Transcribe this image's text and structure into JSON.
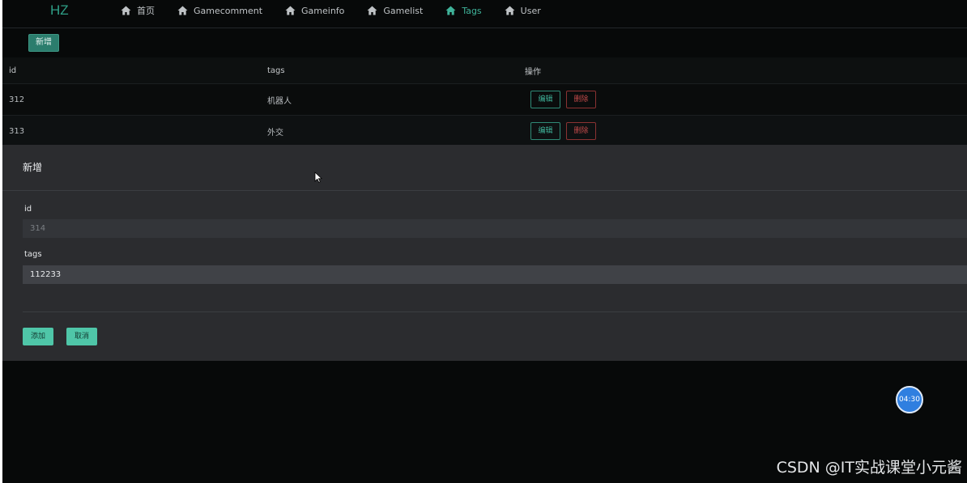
{
  "app": {
    "logo": "HZ"
  },
  "nav": {
    "items": [
      {
        "label": "首页",
        "active": false
      },
      {
        "label": "Gamecomment",
        "active": false
      },
      {
        "label": "Gameinfo",
        "active": false
      },
      {
        "label": "Gamelist",
        "active": false
      },
      {
        "label": "Tags",
        "active": true
      },
      {
        "label": "User",
        "active": false
      }
    ]
  },
  "toolbar": {
    "new_label": "新增"
  },
  "table": {
    "headers": {
      "id": "id",
      "tags": "tags",
      "op": "操作"
    },
    "rows": [
      {
        "id": "312",
        "tags": "机器人",
        "edit": "编辑",
        "delete": "删除"
      },
      {
        "id": "313",
        "tags": "外交",
        "edit": "编辑",
        "delete": "删除"
      }
    ]
  },
  "dialog": {
    "title": "新增",
    "fields": {
      "id": {
        "label": "id",
        "value": "314"
      },
      "tags": {
        "label": "tags",
        "value": "112233"
      }
    },
    "add_label": "添加",
    "cancel_label": "取消"
  },
  "timer": "04:30",
  "watermark": "CSDN @IT实战课堂小元酱",
  "colors": {
    "accent": "#3fb39a",
    "danger": "#c14a4a",
    "button_fill": "#4fc6a8",
    "timer": "#2f7fe0"
  },
  "icons": {
    "nav": "home-icon"
  }
}
